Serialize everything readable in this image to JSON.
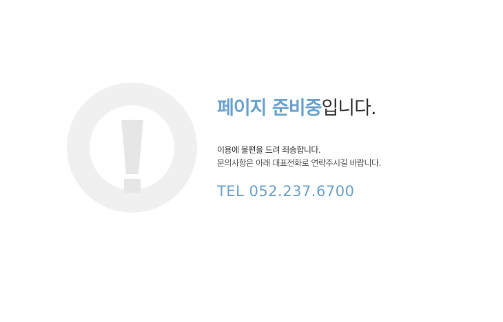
{
  "notice": {
    "headline_accent": "페이지 준비중",
    "headline_rest": "입니다.",
    "message_line1": "이용에 불편을 드려 죄송합니다.",
    "message_line2": "문의사항은 아래 대표전화로 연락주시길 바랍니다.",
    "tel": "TEL 052.237.6700"
  },
  "icons": {
    "alert": "exclamation-circle-icon"
  },
  "colors": {
    "accent": "#6aa3cc",
    "text_dark": "#333333",
    "text_sub": "#555555",
    "icon_gray": "#f0f0f0",
    "icon_mark": "#e6e6e6",
    "background": "#ffffff"
  }
}
